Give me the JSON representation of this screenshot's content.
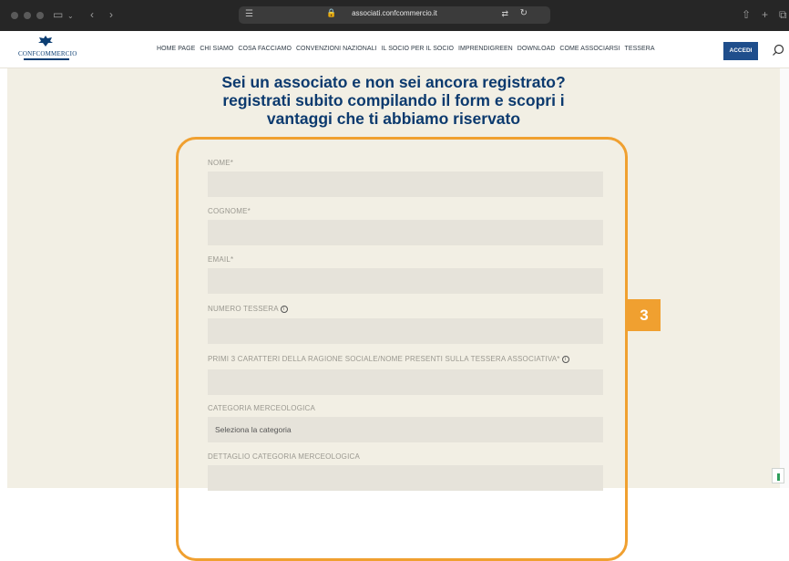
{
  "browser": {
    "url": "associati.confcommercio.it"
  },
  "nav": {
    "logo_text": "CONFCOMMERCIO",
    "menu": [
      "HOME PAGE",
      "CHI SIAMO",
      "COSA FACCIAMO",
      "CONVENZIONI NAZIONALI",
      "IL SOCIO PER IL SOCIO",
      "IMPRENDIGREEN",
      "DOWNLOAD",
      "COME ASSOCIARSI",
      "TESSERA"
    ],
    "login_label": "ACCEDI"
  },
  "page": {
    "heading_lines": [
      "Sei un associato e non sei ancora registrato?",
      "registrati subito compilando il form e scopri i",
      "vantaggi che ti abbiamo riservato"
    ]
  },
  "form": {
    "fields": [
      {
        "label": "NOME*",
        "value": ""
      },
      {
        "label": "COGNOME*",
        "value": ""
      },
      {
        "label": "EMAIL*",
        "value": ""
      },
      {
        "label": "NUMERO TESSERA",
        "value": ""
      },
      {
        "label": "PRIMI 3 CARATTERI DELLA RAGIONE SOCIALE/NOME PRESENTI SULLA TESSERA ASSOCIATIVA*",
        "value": ""
      },
      {
        "label": "CATEGORIA MERCEOLOGICA",
        "value": "Seleziona la categoria"
      },
      {
        "label": "DETTAGLIO CATEGORIA MERCEOLOGICA",
        "value": ""
      }
    ]
  },
  "annotation": {
    "badge": "3"
  },
  "colors": {
    "accent": "#f0a030",
    "brand": "#0c3a6e",
    "button": "#1f4e8c",
    "page_bg": "#f2efe4",
    "field_bg": "#e6e3da"
  }
}
